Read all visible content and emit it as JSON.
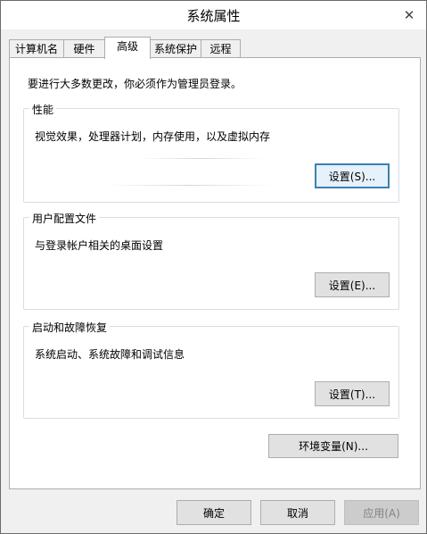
{
  "window": {
    "title": "系统属性",
    "close_glyph": "✕"
  },
  "tabs": [
    {
      "label": "计算机名",
      "active": false
    },
    {
      "label": "硬件",
      "active": false
    },
    {
      "label": "高级",
      "active": true
    },
    {
      "label": "系统保护",
      "active": false
    },
    {
      "label": "远程",
      "active": false
    }
  ],
  "advanced": {
    "admin_note": "要进行大多数更改，你必须作为管理员登录。",
    "performance": {
      "label": "性能",
      "description": "视觉效果，处理器计划，内存使用，以及虚拟内存",
      "button": "设置(S)..."
    },
    "user_profiles": {
      "label": "用户配置文件",
      "description": "与登录帐户相关的桌面设置",
      "button": "设置(E)..."
    },
    "startup_recovery": {
      "label": "启动和故障恢复",
      "description": "系统启动、系统故障和调试信息",
      "button": "设置(T)..."
    },
    "env_button": "环境变量(N)..."
  },
  "footer": {
    "ok": "确定",
    "cancel": "取消",
    "apply": "应用(A)"
  },
  "colors": {
    "window_bg": "#f0f0f0",
    "panel_bg": "#ffffff",
    "button_bg": "#e1e1e1",
    "default_button_border": "#3c7fb1",
    "disabled_text": "#838383"
  }
}
